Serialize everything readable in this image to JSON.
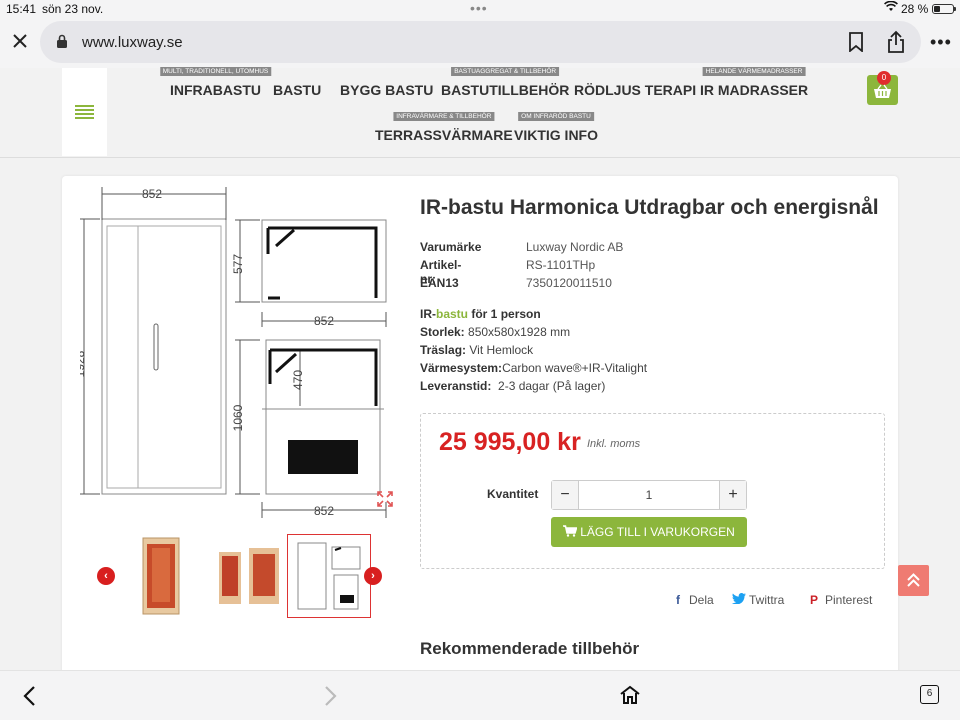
{
  "status": {
    "time": "15:41",
    "date": "sön 23 nov.",
    "battery": "28 %",
    "battery_level": 0.28
  },
  "browser": {
    "url": "www.luxway.se",
    "tab_count": "6"
  },
  "nav": {
    "row1": [
      {
        "label": "INFRABASTU",
        "tag": "MULTI, TRADITIONELL, UTOMHUS"
      },
      {
        "label": "BASTU",
        "tag": ""
      },
      {
        "label": "BYGG BASTU",
        "tag": ""
      },
      {
        "label": "BASTUTILLBEHÖR",
        "tag": "BASTUAGGREGAT & TILLBEHÖR"
      },
      {
        "label": "RÖDLJUS TERAPI",
        "tag": ""
      },
      {
        "label": "IR MADRASSER",
        "tag": "HELANDE VÄRMEMADRASSER"
      }
    ],
    "row2": [
      {
        "label": "TERRASSVÄRMARE",
        "tag": "INFRAVÄRMARE & TILLBEHÖR"
      },
      {
        "label": "VIKTIG INFO",
        "tag": "OM INFRARÖD BASTU"
      }
    ],
    "cart_count": "0"
  },
  "product": {
    "title": "IR-bastu Harmonica Utdragbar och energisnål",
    "meta": [
      {
        "key": "Varumärke",
        "value": "Luxway Nordic AB"
      },
      {
        "key": "Artikel-nr:",
        "value": "RS-1101THp"
      },
      {
        "key": "EAN13",
        "value": "7350120011510"
      }
    ],
    "specs": {
      "type_prefix": "IR-",
      "type_link": "bastu",
      "type_suffix": " för 1 person",
      "size_label": "Storlek:",
      "size_value": " 850x580x1928 mm",
      "wood_label": "Träslag:",
      "wood_value": " Vit Hemlock",
      "heat_label": "Värmesystem:",
      "heat_value": "Carbon wave®+IR-Vitalight",
      "delivery_label": "Leveranstid:",
      "delivery_value": "  2-3 dagar (På lager)"
    },
    "price": "25 995,00 kr",
    "vat": "Inkl. moms",
    "quantity_label": "Kvantitet",
    "quantity": "1",
    "add_to_cart": "LÄGG TILL I VARUKORGEN",
    "share": {
      "dela": "Dela",
      "twitter": "Twittra",
      "pinterest": "Pinterest"
    },
    "recommended": "Rekommenderade tillbehör",
    "drawing_dims": {
      "width_top": "852",
      "height": "1928",
      "depth": "577",
      "width_mid": "852",
      "inner": "470",
      "lower": "1060",
      "width_bottom": "852"
    }
  }
}
